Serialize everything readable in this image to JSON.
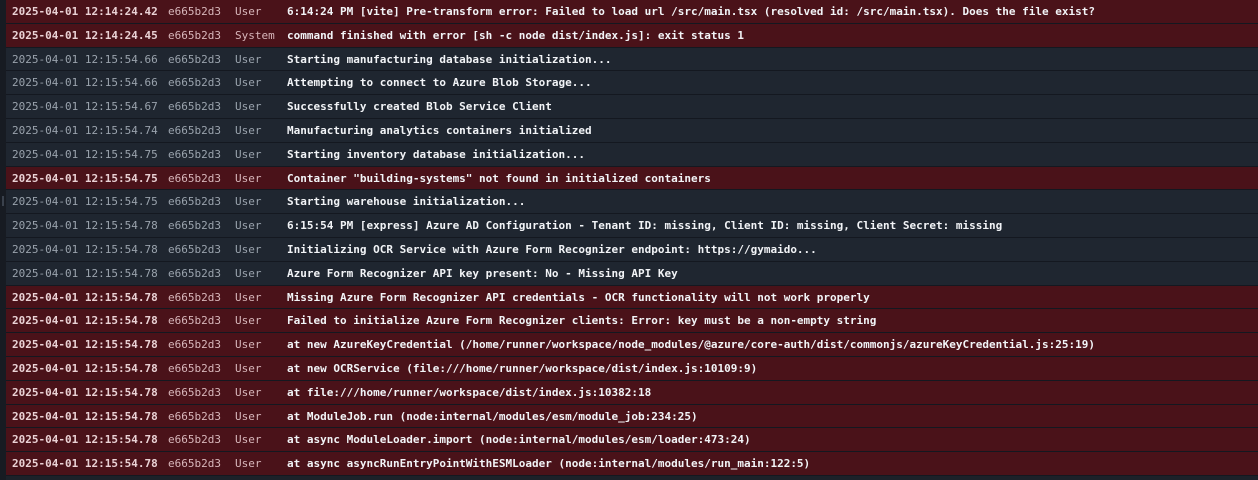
{
  "logs": [
    {
      "level": "error",
      "timestamp": "2025-04-01 12:14:24.42",
      "session": "e665b2d3",
      "source": "User",
      "message": "6:14:24 PM [vite] Pre-transform error: Failed to load url /src/main.tsx (resolved id: /src/main.tsx). Does the file exist?"
    },
    {
      "level": "error",
      "timestamp": "2025-04-01 12:14:24.45",
      "session": "e665b2d3",
      "source": "System",
      "message": "command finished with error [sh -c node dist/index.js]: exit status 1"
    },
    {
      "level": "info",
      "timestamp": "2025-04-01 12:15:54.66",
      "session": "e665b2d3",
      "source": "User",
      "message": "Starting manufacturing database initialization..."
    },
    {
      "level": "info",
      "timestamp": "2025-04-01 12:15:54.66",
      "session": "e665b2d3",
      "source": "User",
      "message": "Attempting to connect to Azure Blob Storage..."
    },
    {
      "level": "info",
      "timestamp": "2025-04-01 12:15:54.67",
      "session": "e665b2d3",
      "source": "User",
      "message": "Successfully created Blob Service Client"
    },
    {
      "level": "info",
      "timestamp": "2025-04-01 12:15:54.74",
      "session": "e665b2d3",
      "source": "User",
      "message": "Manufacturing analytics containers initialized"
    },
    {
      "level": "info",
      "timestamp": "2025-04-01 12:15:54.75",
      "session": "e665b2d3",
      "source": "User",
      "message": "Starting inventory database initialization..."
    },
    {
      "level": "error",
      "timestamp": "2025-04-01 12:15:54.75",
      "session": "e665b2d3",
      "source": "User",
      "message": "Container \"building-systems\" not found in initialized containers"
    },
    {
      "level": "info",
      "timestamp": "2025-04-01 12:15:54.75",
      "session": "e665b2d3",
      "source": "User",
      "message": "Starting warehouse initialization..."
    },
    {
      "level": "info",
      "timestamp": "2025-04-01 12:15:54.78",
      "session": "e665b2d3",
      "source": "User",
      "message": "6:15:54 PM [express] Azure AD Configuration - Tenant ID: missing, Client ID: missing, Client Secret: missing"
    },
    {
      "level": "info",
      "timestamp": "2025-04-01 12:15:54.78",
      "session": "e665b2d3",
      "source": "User",
      "message": "Initializing OCR Service with Azure Form Recognizer endpoint: https://gymaido..."
    },
    {
      "level": "info",
      "timestamp": "2025-04-01 12:15:54.78",
      "session": "e665b2d3",
      "source": "User",
      "message": "Azure Form Recognizer API key present: No - Missing API Key"
    },
    {
      "level": "error",
      "timestamp": "2025-04-01 12:15:54.78",
      "session": "e665b2d3",
      "source": "User",
      "message": "Missing Azure Form Recognizer API credentials - OCR functionality will not work properly"
    },
    {
      "level": "error",
      "timestamp": "2025-04-01 12:15:54.78",
      "session": "e665b2d3",
      "source": "User",
      "message": "Failed to initialize Azure Form Recognizer clients: Error: key must be a non-empty string"
    },
    {
      "level": "error",
      "timestamp": "2025-04-01 12:15:54.78",
      "session": "e665b2d3",
      "source": "User",
      "message": "at new AzureKeyCredential (/home/runner/workspace/node_modules/@azure/core-auth/dist/commonjs/azureKeyCredential.js:25:19)"
    },
    {
      "level": "error",
      "timestamp": "2025-04-01 12:15:54.78",
      "session": "e665b2d3",
      "source": "User",
      "message": "at new OCRService (file:///home/runner/workspace/dist/index.js:10109:9)"
    },
    {
      "level": "error",
      "timestamp": "2025-04-01 12:15:54.78",
      "session": "e665b2d3",
      "source": "User",
      "message": "at file:///home/runner/workspace/dist/index.js:10382:18"
    },
    {
      "level": "error",
      "timestamp": "2025-04-01 12:15:54.78",
      "session": "e665b2d3",
      "source": "User",
      "message": "at ModuleJob.run (node:internal/modules/esm/module_job:234:25)"
    },
    {
      "level": "error",
      "timestamp": "2025-04-01 12:15:54.78",
      "session": "e665b2d3",
      "source": "User",
      "message": "at async ModuleLoader.import (node:internal/modules/esm/loader:473:24)"
    },
    {
      "level": "error",
      "timestamp": "2025-04-01 12:15:54.78",
      "session": "e665b2d3",
      "source": "User",
      "message": "at async asyncRunEntryPointWithESMLoader (node:internal/modules/run_main:122:5)"
    }
  ],
  "colors": {
    "background": "#1c2129",
    "info_row": "#1f2630",
    "error_row": "#4a1219"
  }
}
